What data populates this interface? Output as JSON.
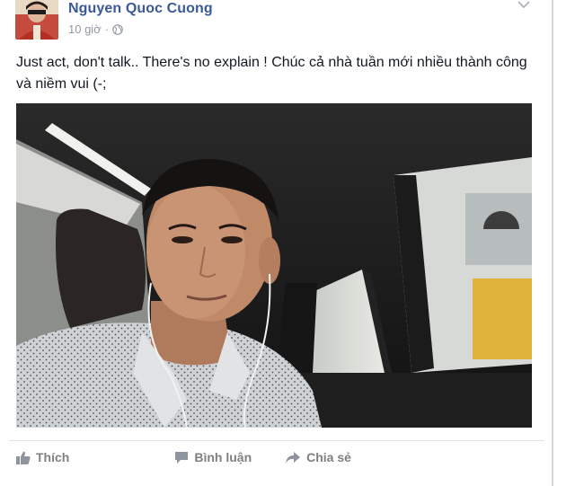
{
  "post": {
    "author": "Nguyen Quoc Cuong",
    "time": "10 giờ",
    "text": "Just act, don't talk.. There's no explain ! Chúc cả nhà tuần mới nhiều thành công và niềm vui (-;"
  },
  "actions": {
    "like_label": "Thích",
    "comment_label": "Bình luận",
    "share_label": "Chia sẻ"
  },
  "colors": {
    "author_link": "#3b5998",
    "meta_text": "#9197a3",
    "action_text": "#7f7f7f"
  },
  "icons": {
    "privacy": "globe-icon",
    "menu": "chevron-down-icon",
    "like": "thumbs-up-icon",
    "comment": "comment-bubble-icon",
    "share": "share-arrow-icon"
  }
}
